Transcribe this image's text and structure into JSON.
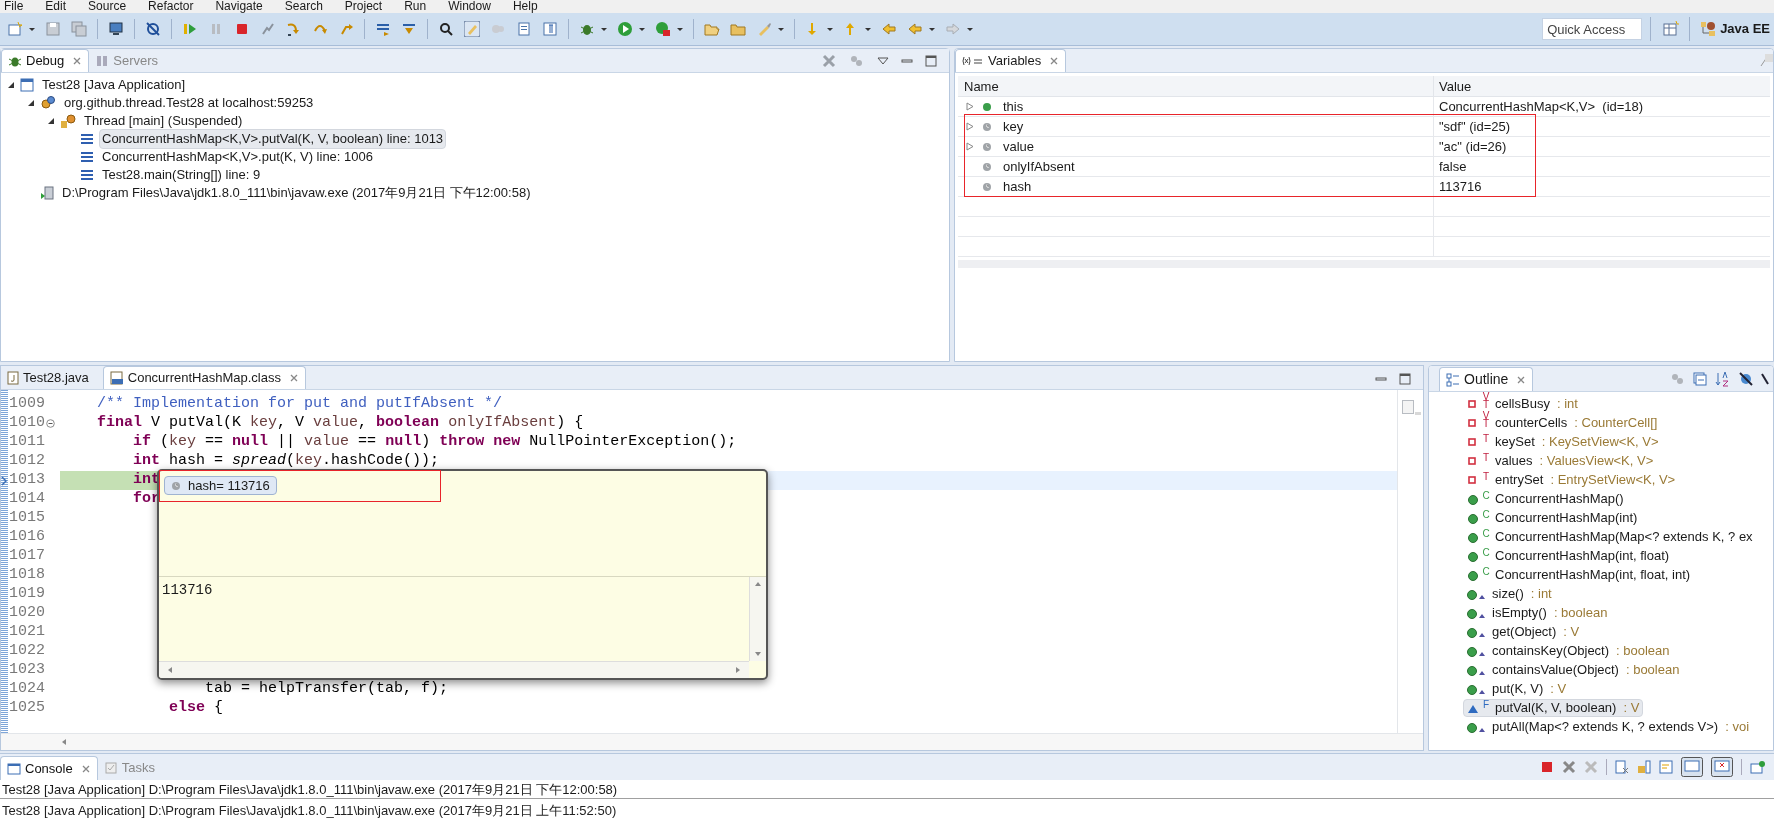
{
  "menu": [
    "File",
    "Edit",
    "Source",
    "Refactor",
    "Navigate",
    "Search",
    "Project",
    "Run",
    "Window",
    "Help"
  ],
  "toolbar": {
    "quick_access": {
      "placeholder": "Quick Access"
    },
    "perspective": "Java EE"
  },
  "debug_view": {
    "tabs": [
      {
        "label": "Debug",
        "selected": true
      },
      {
        "label": "Servers",
        "selected": false
      }
    ],
    "tree": [
      {
        "label": "Test28 [Java Application]",
        "kind": "launch",
        "expanded": true,
        "children": [
          {
            "label": "org.github.thread.Test28 at localhost:59253",
            "kind": "target",
            "expanded": true,
            "children": [
              {
                "label": "Thread [main] (Suspended)",
                "kind": "thread",
                "expanded": true,
                "children": [
                  {
                    "label": "ConcurrentHashMap<K,V>.putVal(K, V, boolean) line: 1013",
                    "kind": "frame",
                    "selected": true
                  },
                  {
                    "label": "ConcurrentHashMap<K,V>.put(K, V) line: 1006",
                    "kind": "frame",
                    "selected": false
                  },
                  {
                    "label": "Test28.main(String[]) line: 9",
                    "kind": "frame",
                    "selected": false
                  }
                ]
              }
            ]
          },
          {
            "label": "D:\\Program Files\\Java\\jdk1.8.0_111\\bin\\javaw.exe (2017年9月21日 下午12:00:58)",
            "kind": "process"
          }
        ]
      }
    ]
  },
  "variables_view": {
    "title": "Variables",
    "columns": [
      "Name",
      "Value"
    ],
    "rows": [
      {
        "name": "this",
        "value": "ConcurrentHashMap<K,V>  (id=18)",
        "kind": "object",
        "expandable": true
      },
      {
        "name": "key",
        "value": "\"sdf\" (id=25)",
        "kind": "local",
        "expandable": true
      },
      {
        "name": "value",
        "value": "\"ac\" (id=26)",
        "kind": "local",
        "expandable": true
      },
      {
        "name": "onlyIfAbsent",
        "value": "false",
        "kind": "local",
        "expandable": false
      },
      {
        "name": "hash",
        "value": "113716",
        "kind": "local",
        "expandable": false
      }
    ]
  },
  "editor": {
    "tabs": [
      {
        "label": "Test28.java",
        "selected": false
      },
      {
        "label": "ConcurrentHashMap.class",
        "selected": true
      }
    ],
    "lines": [
      {
        "number": "1009",
        "current": false,
        "fold": false,
        "tokens": [
          {
            "text": "    /** Implementation for put and putIfAbsent */",
            "kind": "comment"
          }
        ]
      },
      {
        "number": "1010",
        "current": false,
        "fold": true,
        "tokens": [
          {
            "text": "    final",
            "kind": "keyword"
          },
          {
            "text": " V putVal(K ",
            "kind": "plain"
          },
          {
            "text": "key",
            "kind": "param"
          },
          {
            "text": ", V ",
            "kind": "plain"
          },
          {
            "text": "value",
            "kind": "param"
          },
          {
            "text": ", ",
            "kind": "plain"
          },
          {
            "text": "boolean",
            "kind": "keyword"
          },
          {
            "text": " onlyIfAbsent",
            "kind": "param"
          },
          {
            "text": ") {",
            "kind": "plain"
          }
        ]
      },
      {
        "number": "1011",
        "current": false,
        "fold": false,
        "tokens": [
          {
            "text": "        if",
            "kind": "keyword"
          },
          {
            "text": " (",
            "kind": "plain"
          },
          {
            "text": "key",
            "kind": "param"
          },
          {
            "text": " == ",
            "kind": "plain"
          },
          {
            "text": "null",
            "kind": "keyword"
          },
          {
            "text": " || ",
            "kind": "plain"
          },
          {
            "text": "value",
            "kind": "param"
          },
          {
            "text": " == ",
            "kind": "plain"
          },
          {
            "text": "null",
            "kind": "keyword"
          },
          {
            "text": ") ",
            "kind": "plain"
          },
          {
            "text": "throw new",
            "kind": "keyword"
          },
          {
            "text": " NullPointerException();",
            "kind": "plain"
          }
        ]
      },
      {
        "number": "1012",
        "current": false,
        "fold": false,
        "tokens": [
          {
            "text": "        int",
            "kind": "keyword"
          },
          {
            "text": " hash = ",
            "kind": "plain"
          },
          {
            "text": "spread",
            "kind": "static"
          },
          {
            "text": "(",
            "kind": "plain"
          },
          {
            "text": "key",
            "kind": "param"
          },
          {
            "text": ".hashCode());",
            "kind": "plain"
          }
        ]
      },
      {
        "number": "1013",
        "current": true,
        "fold": false,
        "tokens": [
          {
            "text": "        int",
            "kind": "keyword"
          }
        ]
      },
      {
        "number": "1014",
        "current": false,
        "fold": false,
        "tokens": [
          {
            "text": "        for",
            "kind": "keyword"
          }
        ]
      },
      {
        "number": "1015",
        "current": false,
        "fold": false
      },
      {
        "number": "1016",
        "current": false,
        "fold": false
      },
      {
        "number": "1017",
        "current": false,
        "fold": false
      },
      {
        "number": "1018",
        "current": false,
        "fold": false
      },
      {
        "number": "1019",
        "current": false,
        "fold": false
      },
      {
        "number": "1020",
        "current": false,
        "fold": false
      },
      {
        "number": "1021",
        "current": false,
        "fold": false
      },
      {
        "number": "1022",
        "current": false,
        "fold": false
      },
      {
        "number": "1023",
        "current": false,
        "fold": false
      },
      {
        "number": "1024",
        "current": false,
        "fold": false,
        "tokens": [
          {
            "text": "                tab = helpTransfer(tab, f);",
            "kind": "plain"
          }
        ]
      },
      {
        "number": "1025",
        "current": false,
        "fold": false,
        "tokens": [
          {
            "text": "            else",
            "kind": "keyword"
          },
          {
            "text": " {",
            "kind": "plain"
          }
        ]
      }
    ],
    "hover": {
      "label": "hash= 113716",
      "detail": "113716"
    }
  },
  "outline": {
    "title": "Outline",
    "items": [
      {
        "name": "cellsBusy",
        "type": ": int",
        "kind": "field",
        "decorations": [
          "V",
          "T"
        ],
        "selected": false
      },
      {
        "name": "counterCells",
        "type": ": CounterCell[]",
        "kind": "field",
        "decorations": [
          "V",
          "T"
        ],
        "selected": false
      },
      {
        "name": "keySet",
        "type": ": KeySetView<K, V>",
        "kind": "field",
        "decorations": [
          "T"
        ],
        "selected": false
      },
      {
        "name": "values",
        "type": ": ValuesView<K, V>",
        "kind": "field",
        "decorations": [
          "T"
        ],
        "selected": false
      },
      {
        "name": "entrySet",
        "type": ": EntrySetView<K, V>",
        "kind": "field",
        "decorations": [
          "T"
        ],
        "selected": false
      },
      {
        "name": "ConcurrentHashMap()",
        "kind": "constructor",
        "decorations": [
          "C"
        ],
        "selected": false
      },
      {
        "name": "ConcurrentHashMap(int)",
        "kind": "constructor",
        "decorations": [
          "C"
        ],
        "selected": false
      },
      {
        "name": "ConcurrentHashMap(Map<? extends K, ? ex",
        "kind": "constructor",
        "decorations": [
          "C"
        ],
        "selected": false
      },
      {
        "name": "ConcurrentHashMap(int, float)",
        "kind": "constructor",
        "decorations": [
          "C"
        ],
        "selected": false
      },
      {
        "name": "ConcurrentHashMap(int, float, int)",
        "kind": "constructor",
        "decorations": [
          "C"
        ],
        "selected": false
      },
      {
        "name": "size()",
        "type": ": int",
        "kind": "method",
        "selected": false
      },
      {
        "name": "isEmpty()",
        "type": ": boolean",
        "kind": "method",
        "selected": false
      },
      {
        "name": "get(Object)",
        "type": ": V",
        "kind": "method",
        "selected": false
      },
      {
        "name": "containsKey(Object)",
        "type": ": boolean",
        "kind": "method",
        "selected": false
      },
      {
        "name": "containsValue(Object)",
        "type": ": boolean",
        "kind": "method",
        "selected": false
      },
      {
        "name": "put(K, V)",
        "type": ": V",
        "kind": "method",
        "selected": false
      },
      {
        "name": "putVal(K, V, boolean)",
        "type": ": V",
        "kind": "package_method",
        "decorations": [
          "F"
        ],
        "selected": true
      },
      {
        "name": "putAll(Map<? extends K, ? extends V>)",
        "type": ": voi",
        "kind": "method",
        "selected": false
      }
    ]
  },
  "console": {
    "tabs": [
      {
        "label": "Console",
        "selected": true
      },
      {
        "label": "Tasks",
        "selected": false
      }
    ],
    "header": "Test28 [Java Application] D:\\Program Files\\Java\\jdk1.8.0_111\\bin\\javaw.exe (2017年9月21日 下午12:00:58)",
    "output": "Test28 [Java Application] D:\\Program Files\\Java\\jdk1.8.0_111\\bin\\javaw.exe (2017年9月21日 上午11:52:50)"
  }
}
